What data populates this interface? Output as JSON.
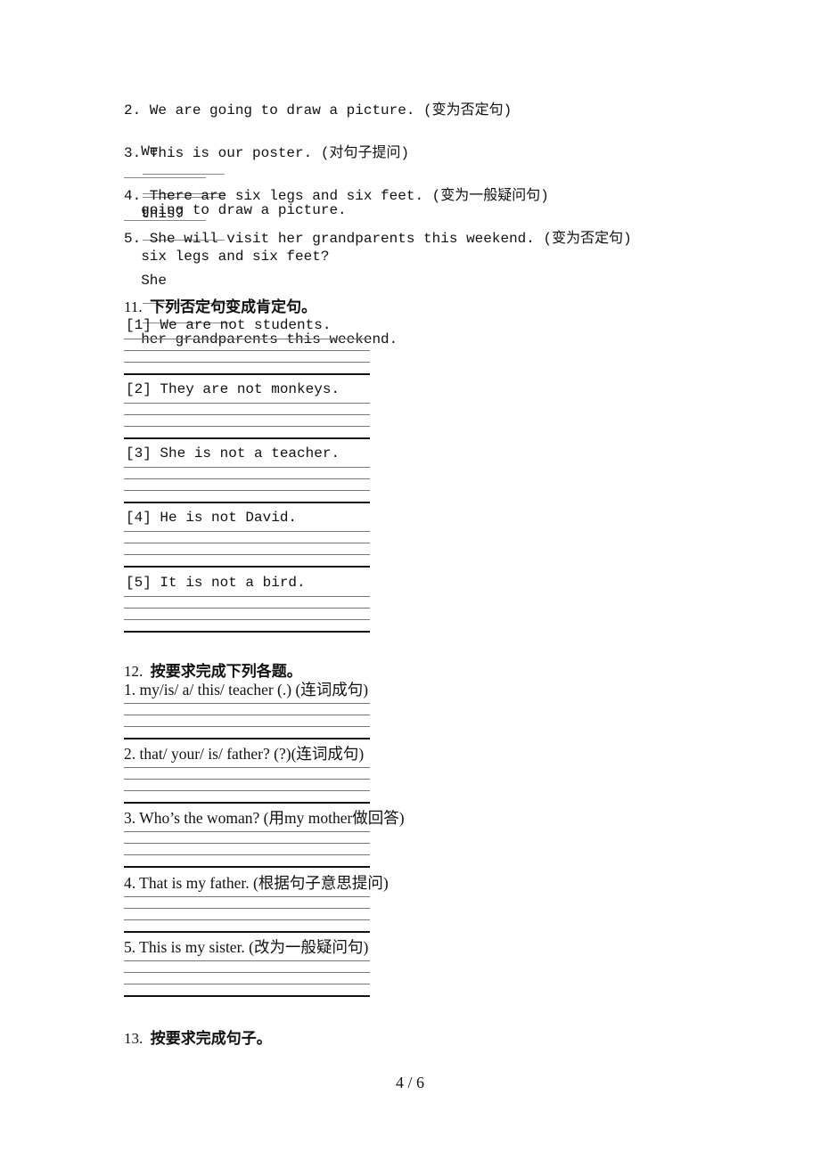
{
  "section10_tail": {
    "items": [
      {
        "question": "2. We are going to draw a picture. (变为否定句)",
        "answer_prefix": "We",
        "answer_suffix": "going to draw a picture."
      },
      {
        "question": "3. This is our poster. (对句子提问)",
        "answer_prefix": "",
        "answer_suffix": "this?"
      },
      {
        "question": "4. There are six legs and six feet. (变为一般疑问句)",
        "answer_prefix": "",
        "answer_suffix": "six legs and six feet?"
      },
      {
        "question": "5. She will visit her grandparents this weekend. (变为否定句)",
        "answer_prefix": "She",
        "answer_suffix": "her grandparents this weekend."
      }
    ]
  },
  "section11": {
    "number": "11.",
    "title": "下列否定句变成肯定句。",
    "items": [
      "[1] We are not students.",
      "[2] They are not monkeys.",
      "[3] She is not a teacher.",
      "[4] He is not David.",
      "[5] It is not a bird."
    ]
  },
  "section12": {
    "number": "12.",
    "title": "按要求完成下列各题。",
    "items": [
      "1. my/is/ a/ this/ teacher (.) (连词成句)",
      "2. that/ your/ is/ father? (?)(连词成句)",
      "3. Who’s the woman? (用my mother做回答)",
      "4. That is my father. (根据句子意思提问)",
      "5. This is my sister. (改为一般疑问句)"
    ]
  },
  "section13": {
    "number": "13.",
    "title": "按要求完成句子。"
  },
  "footer": {
    "page_number": "4 / 6"
  }
}
